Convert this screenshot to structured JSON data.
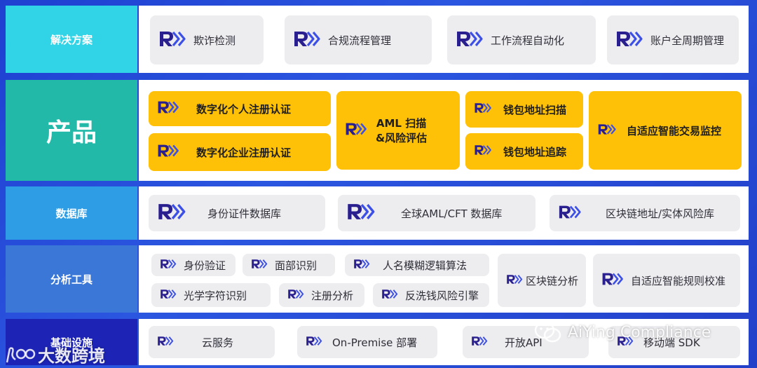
{
  "rows": {
    "solutions": {
      "label": "解决方案",
      "items": [
        "欺诈检测",
        "合规流程管理",
        "工作流程自动化",
        "账户全周期管理"
      ]
    },
    "products": {
      "label": "产品",
      "items": [
        "数字化个人注册认证",
        "数字化企业注册认证",
        "AML 扫描\n&风险评估",
        "钱包地址扫描",
        "钱包地址追踪",
        "自适应智能交易监控"
      ]
    },
    "database": {
      "label": "数据库",
      "items": [
        "身份证件数据库",
        "全球AML/CFT 数据库",
        "区块链地址/实体风险库"
      ]
    },
    "analytics": {
      "label": "分析工具",
      "items": [
        "身份验证",
        "面部识别",
        "人名模糊逻辑算法",
        "光学字符识别",
        "注册分析",
        "反洗钱风险引擎",
        "区块链分析",
        "自适应智能规则校准"
      ]
    },
    "infra": {
      "label": "基础设施",
      "items": [
        "云服务",
        "On-Premise 部署",
        "开放API",
        "移动端 SDK"
      ]
    }
  },
  "watermarks": {
    "wechat": "AiYing Compliance",
    "brand": "大数跨境"
  },
  "colors": {
    "solutions": "#31d3e6",
    "products": "#22b9a8",
    "database": "#2e9de6",
    "analytics": "#3a77d7",
    "infra": "#1d24b5",
    "yellow": "#ffc107",
    "chip": "#ededf0",
    "icon_dark": "#2a1f8f",
    "icon_light": "#3c4fe6"
  },
  "icons": {
    "brand_logo": "R-arrows-icon",
    "wechat": "wechat-icon",
    "brand": "big-data-logo-icon"
  }
}
